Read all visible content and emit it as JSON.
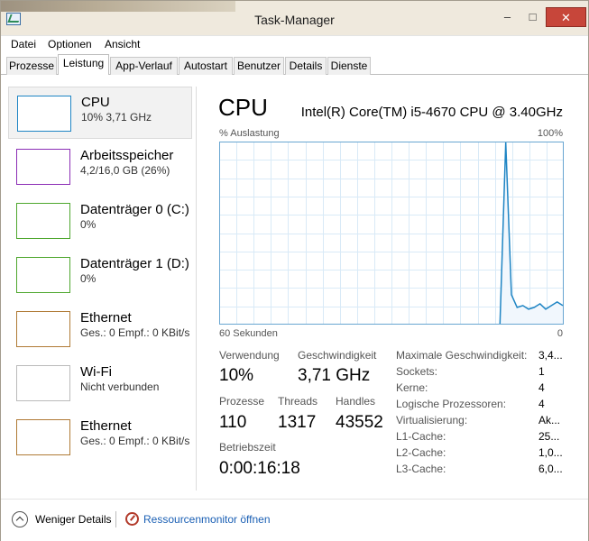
{
  "window": {
    "title": "Task-Manager",
    "min": "–",
    "max": "□",
    "close": "✕",
    "icon": "task-manager-icon"
  },
  "menu": [
    "Datei",
    "Optionen",
    "Ansicht"
  ],
  "tabs": [
    "Prozesse",
    "Leistung",
    "App-Verlauf",
    "Autostart",
    "Benutzer",
    "Details",
    "Dienste"
  ],
  "active_tab": "Leistung",
  "sidebar": [
    {
      "title": "CPU",
      "sub": "10%  3,71 GHz",
      "color": "#1f85c4",
      "selected": true
    },
    {
      "title": "Arbeitsspeicher",
      "sub": "4,2/16,0 GB (26%)",
      "color": "#8b2db5",
      "selected": false
    },
    {
      "title": "Datenträger 0 (C:)",
      "sub": "0%",
      "color": "#4ea72e",
      "selected": false
    },
    {
      "title": "Datenträger 1 (D:)",
      "sub": "0%",
      "color": "#4ea72e",
      "selected": false
    },
    {
      "title": "Ethernet",
      "sub": "Ges.: 0  Empf.: 0 KBit/s",
      "color": "#b07a35",
      "selected": false
    },
    {
      "title": "Wi-Fi",
      "sub": "Nicht verbunden",
      "color": "#bbbbbb",
      "selected": false
    },
    {
      "title": "Ethernet",
      "sub": "Ges.: 0  Empf.: 0 KBit/s",
      "color": "#b07a35",
      "selected": false
    }
  ],
  "main": {
    "title": "CPU",
    "model": "Intel(R) Core(TM) i5-4670 CPU @ 3.40GHz",
    "y_label": "% Auslastung",
    "y_max": "100%",
    "x_label": "60 Sekunden",
    "x_min": "0",
    "chart_color": "#1f85c4",
    "chart_grid_color": "#d9eaf7",
    "chart_border_color": "#69a6d1"
  },
  "stats": {
    "verwendung_label": "Verwendung",
    "verwendung": "10%",
    "geschwindigkeit_label": "Geschwindigkeit",
    "geschwindigkeit": "3,71 GHz",
    "prozesse_label": "Prozesse",
    "prozesse": "110",
    "threads_label": "Threads",
    "threads": "1317",
    "handles_label": "Handles",
    "handles": "43552",
    "betriebszeit_label": "Betriebszeit",
    "betriebszeit": "0:00:16:18"
  },
  "specs": [
    {
      "label": "Maximale Geschwindigkeit:",
      "value": "3,4..."
    },
    {
      "label": "Sockets:",
      "value": "1"
    },
    {
      "label": "Kerne:",
      "value": "4"
    },
    {
      "label": "Logische Prozessoren:",
      "value": "4"
    },
    {
      "label": "Virtualisierung:",
      "value": "Ak..."
    },
    {
      "label": "L1-Cache:",
      "value": "25..."
    },
    {
      "label": "L2-Cache:",
      "value": "1,0..."
    },
    {
      "label": "L3-Cache:",
      "value": "6,0..."
    }
  ],
  "footer": {
    "less": "Weniger Details",
    "resmon": "Ressourcenmonitor öffnen"
  },
  "chart_data": {
    "type": "line",
    "x": [
      60,
      59,
      58,
      57,
      56,
      55,
      54,
      53,
      52,
      51,
      50,
      49,
      48,
      47,
      46,
      45,
      44,
      43,
      42,
      41,
      40,
      39,
      38,
      37,
      36,
      35,
      34,
      33,
      32,
      31,
      30,
      29,
      28,
      27,
      26,
      25,
      24,
      23,
      22,
      21,
      20,
      19,
      18,
      17,
      16,
      15,
      14,
      13,
      12,
      11,
      10,
      9,
      8,
      7,
      6,
      5,
      4,
      3,
      2,
      1,
      0
    ],
    "series": [
      {
        "values": [
          null,
          null,
          null,
          null,
          null,
          null,
          null,
          null,
          null,
          null,
          null,
          null,
          null,
          null,
          null,
          null,
          null,
          null,
          null,
          null,
          null,
          null,
          null,
          null,
          null,
          null,
          null,
          null,
          null,
          null,
          null,
          null,
          null,
          null,
          null,
          null,
          null,
          null,
          null,
          null,
          null,
          null,
          null,
          null,
          null,
          null,
          null,
          null,
          null,
          0,
          100,
          16,
          9,
          10,
          8,
          9,
          11,
          8,
          10,
          12,
          10
        ]
      }
    ],
    "xlabel": "60 Sekunden",
    "ylabel": "% Auslastung",
    "ylim": [
      0,
      100
    ],
    "grid": true
  }
}
